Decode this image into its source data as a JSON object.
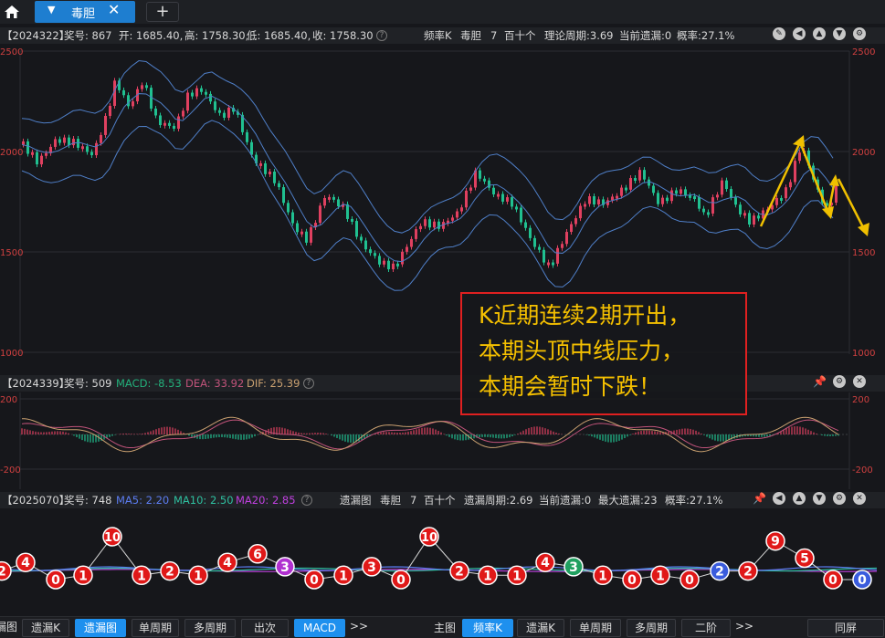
{
  "tab": {
    "label": "毒胆",
    "close": "✕"
  },
  "toolbar": {
    "add": "+"
  },
  "kline": {
    "period": "【2024322】",
    "award": "奖号: 867",
    "open": "开: 1685.40,",
    "high": "高: 1758.30,",
    "low": "低: 1685.40,",
    "close": "收: 1758.30",
    "mode": "频率K",
    "type": "毒胆",
    "num": "7",
    "place": "百十个",
    "theory": "理论周期:3.69",
    "current": "当前遗漏:0",
    "prob": "概率:27.1%",
    "y_left": [
      "2500",
      "2000",
      "1500",
      "1000"
    ],
    "y_right": [
      "2500",
      "2000",
      "1500",
      "1000"
    ]
  },
  "macd": {
    "period": "【2024339】",
    "award": "奖号: 509",
    "macd": "MACD: -8.53",
    "dea": "DEA: 33.92",
    "dif": "DIF: 25.39",
    "y_left": [
      "200",
      "-200"
    ],
    "y_right": [
      "200",
      "-200"
    ],
    "colors": {
      "macd": "#23b07b",
      "dea": "#c0537a",
      "dif": "#c9a070"
    }
  },
  "miss": {
    "period": "【2025070】",
    "award": "奖号: 748",
    "ma5": "MA5: 2.20",
    "ma10": "MA10: 2.50",
    "ma20": "MA20: 2.85",
    "title": "遗漏图",
    "type": "毒胆",
    "num": "7",
    "place": "百十个",
    "cycle": "遗漏周期:2.69",
    "current": "当前遗漏:0",
    "max": "最大遗漏:23",
    "prob": "概率:27.1%",
    "colors": {
      "ma5": "#5b7cf0",
      "ma10": "#2ec0a0",
      "ma20": "#c040e0"
    },
    "nodes": [
      "2",
      "4",
      "0",
      "1",
      "10",
      "1",
      "2",
      "1",
      "4",
      "6",
      "3",
      "0",
      "1",
      "3",
      "0",
      "10",
      "2",
      "1",
      "1",
      "4",
      "3",
      "1",
      "0",
      "1",
      "0",
      "2",
      "2",
      "9",
      "5",
      "0",
      "0"
    ]
  },
  "annotation": {
    "line1": "K近期连续2期开出，",
    "line2": "本期头顶中线压力，",
    "line3": "本期会暂时下跌！"
  },
  "bottom": {
    "left_partial": "漏图",
    "left_tabs": [
      "遗漏K",
      "遗漏图",
      "单周期",
      "多周期",
      "出次",
      "MACD"
    ],
    "more": ">>",
    "main_label": "主图",
    "right_tabs": [
      "频率K",
      "遗漏K",
      "单周期",
      "多周期",
      "二阶"
    ],
    "more2": ">>",
    "fullscreen": "同屏"
  }
}
